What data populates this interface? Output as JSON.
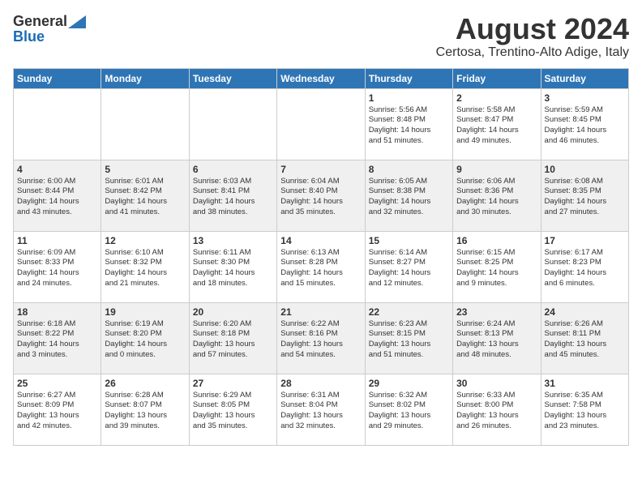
{
  "header": {
    "logo_general": "General",
    "logo_blue": "Blue",
    "main_title": "August 2024",
    "subtitle": "Certosa, Trentino-Alto Adige, Italy"
  },
  "weekdays": [
    "Sunday",
    "Monday",
    "Tuesday",
    "Wednesday",
    "Thursday",
    "Friday",
    "Saturday"
  ],
  "weeks": [
    [
      {
        "day": "",
        "detail": ""
      },
      {
        "day": "",
        "detail": ""
      },
      {
        "day": "",
        "detail": ""
      },
      {
        "day": "",
        "detail": ""
      },
      {
        "day": "1",
        "detail": "Sunrise: 5:56 AM\nSunset: 8:48 PM\nDaylight: 14 hours\nand 51 minutes."
      },
      {
        "day": "2",
        "detail": "Sunrise: 5:58 AM\nSunset: 8:47 PM\nDaylight: 14 hours\nand 49 minutes."
      },
      {
        "day": "3",
        "detail": "Sunrise: 5:59 AM\nSunset: 8:45 PM\nDaylight: 14 hours\nand 46 minutes."
      }
    ],
    [
      {
        "day": "4",
        "detail": "Sunrise: 6:00 AM\nSunset: 8:44 PM\nDaylight: 14 hours\nand 43 minutes."
      },
      {
        "day": "5",
        "detail": "Sunrise: 6:01 AM\nSunset: 8:42 PM\nDaylight: 14 hours\nand 41 minutes."
      },
      {
        "day": "6",
        "detail": "Sunrise: 6:03 AM\nSunset: 8:41 PM\nDaylight: 14 hours\nand 38 minutes."
      },
      {
        "day": "7",
        "detail": "Sunrise: 6:04 AM\nSunset: 8:40 PM\nDaylight: 14 hours\nand 35 minutes."
      },
      {
        "day": "8",
        "detail": "Sunrise: 6:05 AM\nSunset: 8:38 PM\nDaylight: 14 hours\nand 32 minutes."
      },
      {
        "day": "9",
        "detail": "Sunrise: 6:06 AM\nSunset: 8:36 PM\nDaylight: 14 hours\nand 30 minutes."
      },
      {
        "day": "10",
        "detail": "Sunrise: 6:08 AM\nSunset: 8:35 PM\nDaylight: 14 hours\nand 27 minutes."
      }
    ],
    [
      {
        "day": "11",
        "detail": "Sunrise: 6:09 AM\nSunset: 8:33 PM\nDaylight: 14 hours\nand 24 minutes."
      },
      {
        "day": "12",
        "detail": "Sunrise: 6:10 AM\nSunset: 8:32 PM\nDaylight: 14 hours\nand 21 minutes."
      },
      {
        "day": "13",
        "detail": "Sunrise: 6:11 AM\nSunset: 8:30 PM\nDaylight: 14 hours\nand 18 minutes."
      },
      {
        "day": "14",
        "detail": "Sunrise: 6:13 AM\nSunset: 8:28 PM\nDaylight: 14 hours\nand 15 minutes."
      },
      {
        "day": "15",
        "detail": "Sunrise: 6:14 AM\nSunset: 8:27 PM\nDaylight: 14 hours\nand 12 minutes."
      },
      {
        "day": "16",
        "detail": "Sunrise: 6:15 AM\nSunset: 8:25 PM\nDaylight: 14 hours\nand 9 minutes."
      },
      {
        "day": "17",
        "detail": "Sunrise: 6:17 AM\nSunset: 8:23 PM\nDaylight: 14 hours\nand 6 minutes."
      }
    ],
    [
      {
        "day": "18",
        "detail": "Sunrise: 6:18 AM\nSunset: 8:22 PM\nDaylight: 14 hours\nand 3 minutes."
      },
      {
        "day": "19",
        "detail": "Sunrise: 6:19 AM\nSunset: 8:20 PM\nDaylight: 14 hours\nand 0 minutes."
      },
      {
        "day": "20",
        "detail": "Sunrise: 6:20 AM\nSunset: 8:18 PM\nDaylight: 13 hours\nand 57 minutes."
      },
      {
        "day": "21",
        "detail": "Sunrise: 6:22 AM\nSunset: 8:16 PM\nDaylight: 13 hours\nand 54 minutes."
      },
      {
        "day": "22",
        "detail": "Sunrise: 6:23 AM\nSunset: 8:15 PM\nDaylight: 13 hours\nand 51 minutes."
      },
      {
        "day": "23",
        "detail": "Sunrise: 6:24 AM\nSunset: 8:13 PM\nDaylight: 13 hours\nand 48 minutes."
      },
      {
        "day": "24",
        "detail": "Sunrise: 6:26 AM\nSunset: 8:11 PM\nDaylight: 13 hours\nand 45 minutes."
      }
    ],
    [
      {
        "day": "25",
        "detail": "Sunrise: 6:27 AM\nSunset: 8:09 PM\nDaylight: 13 hours\nand 42 minutes."
      },
      {
        "day": "26",
        "detail": "Sunrise: 6:28 AM\nSunset: 8:07 PM\nDaylight: 13 hours\nand 39 minutes."
      },
      {
        "day": "27",
        "detail": "Sunrise: 6:29 AM\nSunset: 8:05 PM\nDaylight: 13 hours\nand 35 minutes."
      },
      {
        "day": "28",
        "detail": "Sunrise: 6:31 AM\nSunset: 8:04 PM\nDaylight: 13 hours\nand 32 minutes."
      },
      {
        "day": "29",
        "detail": "Sunrise: 6:32 AM\nSunset: 8:02 PM\nDaylight: 13 hours\nand 29 minutes."
      },
      {
        "day": "30",
        "detail": "Sunrise: 6:33 AM\nSunset: 8:00 PM\nDaylight: 13 hours\nand 26 minutes."
      },
      {
        "day": "31",
        "detail": "Sunrise: 6:35 AM\nSunset: 7:58 PM\nDaylight: 13 hours\nand 23 minutes."
      }
    ]
  ]
}
